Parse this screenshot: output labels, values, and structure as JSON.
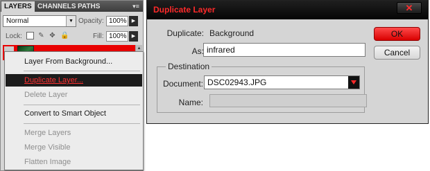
{
  "layers_panel": {
    "tabs": [
      "LAYERS",
      "CHANNELS",
      "PATHS"
    ],
    "active_tab": "LAYERS",
    "blend_mode": "Normal",
    "opacity_label": "Opacity:",
    "opacity_value": "100%",
    "lock_label": "Lock:",
    "fill_label": "Fill:",
    "fill_value": "100%",
    "selected_layer_color": "#e90000"
  },
  "context_menu": {
    "items": [
      {
        "label": "Layer From Background...",
        "enabled": true
      },
      {
        "label": "Duplicate Layer...",
        "enabled": true,
        "highlighted": true
      },
      {
        "label": "Delete Layer",
        "enabled": false
      },
      {
        "label": "Convert to Smart Object",
        "enabled": true
      },
      {
        "label": "Merge Layers",
        "enabled": false
      },
      {
        "label": "Merge Visible",
        "enabled": false
      },
      {
        "label": "Flatten Image",
        "enabled": false
      }
    ]
  },
  "dialog": {
    "title": "Duplicate Layer",
    "close_glyph": "✕",
    "duplicate_label": "Duplicate:",
    "duplicate_value": "Background",
    "as_label": "As:",
    "as_value": "infrared",
    "destination_label": "Destination",
    "document_label": "Document:",
    "document_value": "DSC02943.JPG",
    "name_label": "Name:",
    "name_value": "",
    "ok_label": "OK",
    "cancel_label": "Cancel",
    "accent_color": "#ff2a2a"
  }
}
